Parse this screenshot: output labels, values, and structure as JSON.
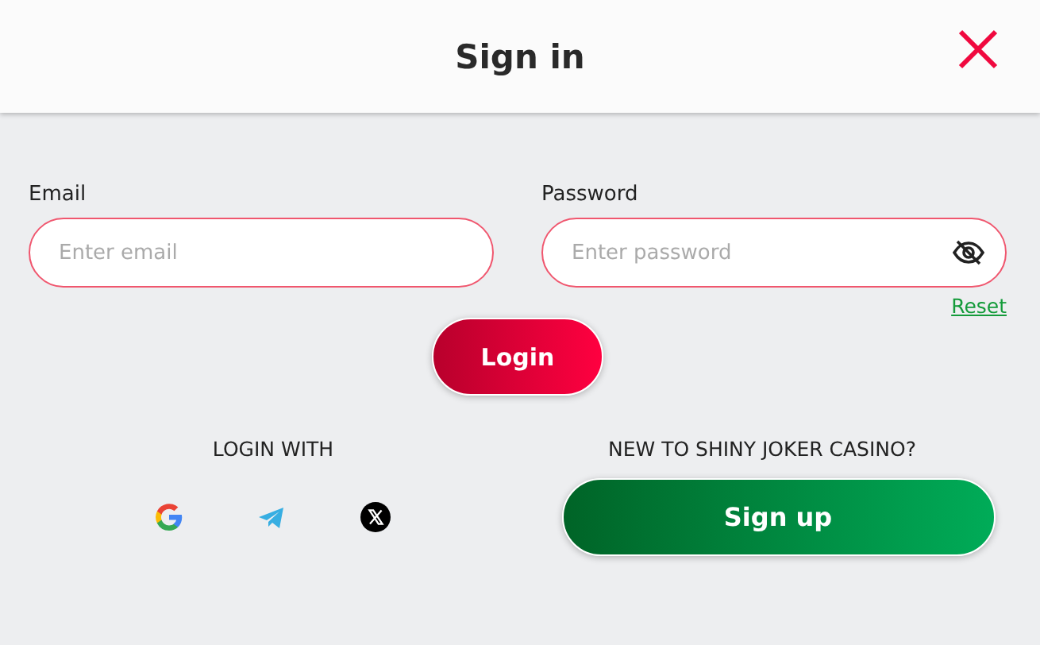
{
  "window": {
    "title": "Sign in"
  },
  "fields": [
    {
      "label": "Email",
      "placeholder": "Enter email",
      "kind": "email"
    },
    {
      "label": "Password",
      "placeholder": "Enter password",
      "kind": "password"
    }
  ],
  "reset_link": "Reset",
  "login_button": "Login",
  "login_with": {
    "heading": "LOGIN WITH",
    "providers": [
      {
        "kind": "google"
      },
      {
        "kind": "telegram"
      },
      {
        "kind": "x"
      }
    ]
  },
  "signup": {
    "heading": "NEW TO SHINY JOKER CASINO?",
    "button": "Sign up"
  }
}
